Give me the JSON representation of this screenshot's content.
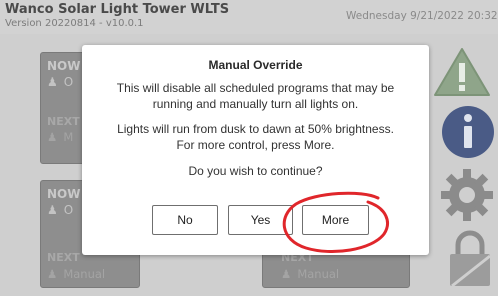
{
  "header": {
    "title": "Wanco Solar Light Tower WLTS",
    "version": "Version 20220814 - v10.0.1",
    "datetime": "Wednesday 9/21/2022 20:32"
  },
  "tiles": [
    {
      "now_label": "NOW",
      "now_mode": "O",
      "next_label": "NEXT",
      "next_mode": "M"
    },
    {
      "now_label": "NOW",
      "now_mode": "O",
      "next_label": "NEXT",
      "next_mode": "Manual"
    },
    {
      "now_label": "",
      "now_mode": "",
      "next_label": "NEXT",
      "next_mode": "Manual"
    }
  ],
  "sidebar_icons": [
    "warning-icon",
    "info-icon",
    "gear-icon",
    "lock-icon"
  ],
  "modal": {
    "title": "Manual Override",
    "line1": "This will disable all scheduled programs that may be",
    "line2": "running and manually turn all lights on.",
    "line3": "Lights will run from dusk to dawn at 50% brightness.",
    "line4": "For more control, press More.",
    "line5": "Do you wish to continue?",
    "buttons": {
      "no": "No",
      "yes": "Yes",
      "more": "More"
    }
  },
  "colors": {
    "warning": "#8fa58a",
    "info": "#4a5b86",
    "annotation": "#e0262b"
  }
}
